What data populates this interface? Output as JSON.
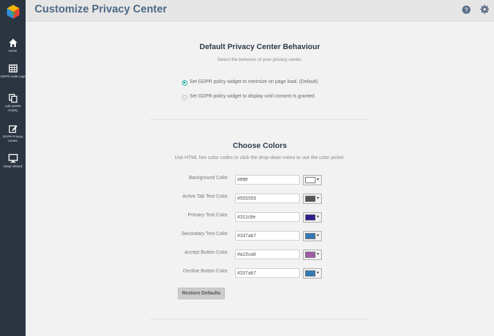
{
  "header": {
    "title": "Customize Privacy Center",
    "help_icon": "question-circle-icon",
    "settings_icon": "gear-icon"
  },
  "sidebar": {
    "items": [
      {
        "label": "Home",
        "icon": "home-icon"
      },
      {
        "label": "GDPR Audit Logs",
        "icon": "table-icon"
      },
      {
        "label": "Add GDPR Activity",
        "icon": "copy-icon"
      },
      {
        "label": "GDPR Privacy Center",
        "icon": "edit-icon"
      },
      {
        "label": "Setup Wizard",
        "icon": "monitor-icon"
      }
    ]
  },
  "behaviour": {
    "title": "Default Privacy Center Behaviour",
    "subtitle": "Select the behviour of your privacy center.",
    "options": [
      {
        "label": "Set GDPR policy widget to minimize on page load. (Default)",
        "selected": true
      },
      {
        "label": "Set GDPR policy widget to display until consent is granted.",
        "selected": false
      }
    ]
  },
  "colors": {
    "title": "Choose Colors",
    "subtitle": "Use HTML hex color codes or click the drop-down menu to use the color picker.",
    "rows": [
      {
        "label": "Background Color",
        "value": "#ffffff",
        "swatch": "#ffffff"
      },
      {
        "label": "Active Tab Text Color",
        "value": "#555555",
        "swatch": "#555555"
      },
      {
        "label": "Primary Text Color",
        "value": "#311c8e",
        "swatch": "#311c8e"
      },
      {
        "label": "Secondary Text Color",
        "value": "#337ab7",
        "swatch": "#337ab7"
      },
      {
        "label": "Accept Button Color",
        "value": "#a15ca8",
        "swatch": "#a15ca8"
      },
      {
        "label": "Decline Button Color",
        "value": "#337ab7",
        "swatch": "#337ab7"
      }
    ],
    "restore_label": "Restore Defaults"
  }
}
